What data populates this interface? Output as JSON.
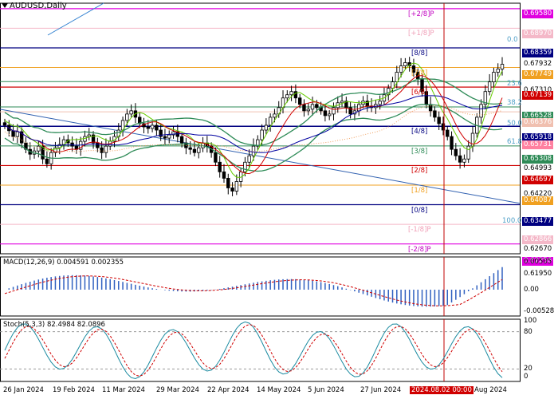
{
  "title": "AUDUSD,Daily",
  "price_labels": [
    {
      "text": "0.69580",
      "bg": "#e000e0",
      "fg": "#ffffff"
    },
    {
      "text": "0.68970",
      "bg": "#f4b8c8",
      "fg": "#ffffff"
    },
    {
      "text": "0.68359",
      "bg": "#000080",
      "fg": "#ffffff"
    },
    {
      "text": "0.67932",
      "bg": null,
      "fg": "#000000"
    },
    {
      "text": "0.67749",
      "bg": "#f0a020",
      "fg": "#ffffff"
    },
    {
      "text": "0.67310",
      "bg": null,
      "fg": "#000000"
    },
    {
      "text": "0.67139",
      "bg": "#d00000",
      "fg": "#ffffff"
    },
    {
      "text": "0.66528",
      "bg": "#2e8b57",
      "fg": "#ffffff"
    },
    {
      "text": "0.66376",
      "bg": "#f0c0b0",
      "fg": "#ffffff"
    },
    {
      "text": "0.65918",
      "bg": "#000080",
      "fg": "#ffffff"
    },
    {
      "text": "0.65731",
      "bg": "#ff80a0",
      "fg": "#ffffff"
    },
    {
      "text": "0.65308",
      "bg": "#2e8b57",
      "fg": "#ffffff"
    },
    {
      "text": "0.64993",
      "bg": null,
      "fg": "#000000"
    },
    {
      "text": "0.64697",
      "bg": "#d00000",
      "fg": "#ffffff"
    },
    {
      "text": "0.64220",
      "bg": null,
      "fg": "#000000"
    },
    {
      "text": "0.64087",
      "bg": "#f0a020",
      "fg": "#ffffff"
    },
    {
      "text": "0.63477",
      "bg": "#000080",
      "fg": "#ffffff"
    },
    {
      "text": "0.62670",
      "bg": null,
      "fg": "#000000"
    },
    {
      "text": "0.62866",
      "bg": "#f4b8c8",
      "fg": "#ffffff"
    },
    {
      "text": "0.62256",
      "bg": "#e000e0",
      "fg": "#ffffff"
    },
    {
      "text": "0.61950",
      "bg": null,
      "fg": "#000000"
    }
  ],
  "murrey_levels": [
    "[+2/8]P",
    "[+1/8]P",
    "[8/8]",
    "[7/8]",
    "[6/8]",
    "[4/8]",
    "[3/8]",
    "[2/8]",
    "[1/8]",
    "[0/8]",
    "[-1/8]P",
    "[-2/8]P"
  ],
  "fib_labels": [
    "0.0",
    "23.6",
    "38.2",
    "50.0",
    "61.8",
    "100.0"
  ],
  "date_labels": [
    "26 Jan 2024",
    "19 Feb 2024",
    "11 Mar 2024",
    "29 Mar 2024",
    "22 Apr 2024",
    "14 May 2024",
    "5 Jun 2024",
    "27 Jun 2024",
    "2024.08.02 00:00",
    "Aug 2024"
  ],
  "macd": {
    "label": "MACD(12,26,9) 0.004591 0.002355",
    "axis": [
      "0.00505",
      "0.00",
      "-0.00528"
    ]
  },
  "stoch": {
    "label": "Stoch(5,3,3) 82.4984 82.0896",
    "axis": [
      "100",
      "80",
      "20",
      "0"
    ]
  },
  "chart_data": {
    "type": "candlestick",
    "symbol": "AUDUSD",
    "timeframe": "Daily",
    "ylim": [
      0.6195,
      0.6975
    ],
    "levels": {
      "plus_2_8": 0.6958,
      "plus_1_8": 0.6897,
      "8_8": 0.68359,
      "7_8": 0.67749,
      "6_8": 0.67139,
      "4_8": 0.65918,
      "3_8": 0.65308,
      "2_8": 0.64697,
      "1_8": 0.64087,
      "0_8": 0.63477,
      "minus_1_8": 0.62866,
      "minus_2_8": 0.62256
    },
    "close_series": [
      0.6595,
      0.6578,
      0.656,
      0.6575,
      0.654,
      0.652,
      0.6505,
      0.6515,
      0.653,
      0.649,
      0.6475,
      0.651,
      0.6525,
      0.6535,
      0.655,
      0.654,
      0.653,
      0.652,
      0.6545,
      0.656,
      0.6565,
      0.654,
      0.6525,
      0.651,
      0.653,
      0.6545,
      0.656,
      0.658,
      0.661,
      0.663,
      0.664,
      0.662,
      0.66,
      0.659,
      0.6585,
      0.6595,
      0.658,
      0.656,
      0.6555,
      0.6565,
      0.6575,
      0.656,
      0.654,
      0.6525,
      0.652,
      0.651,
      0.6525,
      0.654,
      0.653,
      0.651,
      0.648,
      0.645,
      0.643,
      0.64,
      0.639,
      0.642,
      0.645,
      0.648,
      0.65,
      0.653,
      0.655,
      0.658,
      0.6595,
      0.662,
      0.663,
      0.665,
      0.668,
      0.669,
      0.67,
      0.668,
      0.666,
      0.664,
      0.6645,
      0.666,
      0.665,
      0.664,
      0.6625,
      0.663,
      0.665,
      0.6665,
      0.667,
      0.665,
      0.663,
      0.664,
      0.666,
      0.667,
      0.6655,
      0.665,
      0.666,
      0.667,
      0.669,
      0.671,
      0.673,
      0.676,
      0.678,
      0.679,
      0.678,
      0.676,
      0.674,
      0.67,
      0.666,
      0.664,
      0.662,
      0.66,
      0.658,
      0.656,
      0.652,
      0.65,
      0.648,
      0.649,
      0.653,
      0.657,
      0.662,
      0.666,
      0.67,
      0.673,
      0.676,
      0.677,
      0.6785
    ],
    "macd": {
      "macd_value": 0.004591,
      "signal_value": 0.002355,
      "ylim": [
        -0.00528,
        0.00505
      ]
    },
    "stoch": {
      "k_value": 82.4984,
      "d_value": 82.0896,
      "levels": [
        80,
        20
      ]
    },
    "vline_date": "2024.08.02 00:00"
  }
}
